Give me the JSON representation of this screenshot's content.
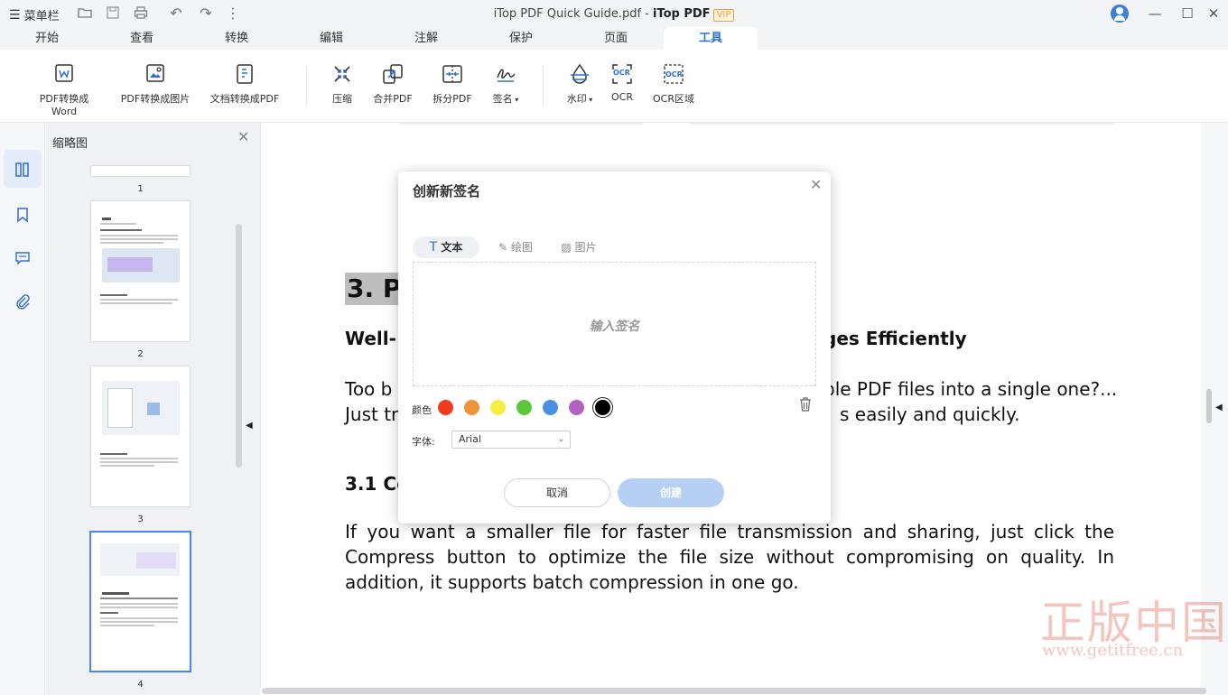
{
  "titlebar": {
    "menu_label": "菜单栏",
    "file_name": "iTop PDF Quick Guide.pdf - ",
    "brand": "iTop PDF",
    "vip": "VIP"
  },
  "tabs": [
    "开始",
    "查看",
    "转换",
    "编辑",
    "注解",
    "保护",
    "页面",
    "工具"
  ],
  "active_tab": "工具",
  "ribbon": {
    "pdf_to_word": "PDF转换成Word",
    "pdf_to_image": "PDF转换成图片",
    "doc_to_pdf": "文档转换成PDF",
    "compress": "压缩",
    "merge": "合并PDF",
    "split": "拆分PDF",
    "sign": "签名",
    "watermark": "水印",
    "ocr": "OCR",
    "ocr_area": "OCR区域",
    "ocr_badge": "OCR"
  },
  "thumbnails": {
    "title": "缩略图",
    "pages": [
      "1",
      "2",
      "3",
      "4"
    ],
    "selected_page": "4"
  },
  "document": {
    "heading": "3. Pa",
    "sub_left": "Well-",
    "sub_right": "ges Efficiently",
    "p1_left": "Too b",
    "p1_right": "ple PDF files into a single one?...",
    "p2_left": "Just tr",
    "p2_right": "s easily and quickly.",
    "section": "3.1 Co",
    "para_line1": "If you want a smaller file for faster file transmission and sharing, just click the",
    "para_line2": "Compress button to optimize the file size without compromising on quality. In",
    "para_line3": "addition, it supports batch compression in one go."
  },
  "watermark": {
    "chinese": "正版中国",
    "url": "www.getitfree.cn"
  },
  "dialog": {
    "title": "创新新签名",
    "tabs": [
      "文本",
      "绘图",
      "图片"
    ],
    "active_tab": "文本",
    "placeholder": "输入签名",
    "color_label": "颜色",
    "colors": [
      "#f23b1c",
      "#f0923a",
      "#f6ee3f",
      "#5cc73a",
      "#4a90e2",
      "#b45fc4",
      "#000000"
    ],
    "selected_color": "#000000",
    "font_label": "字体:",
    "font_value": "Arial",
    "cancel": "取消",
    "create": "创建"
  }
}
